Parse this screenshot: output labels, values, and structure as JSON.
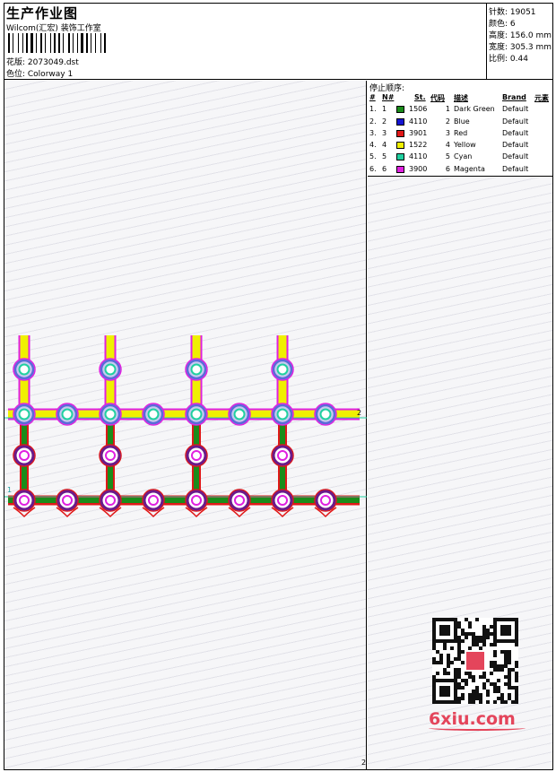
{
  "header": {
    "title": "生产作业图",
    "company": "Wilcom(汇宏) 装饰工作室",
    "design_label": "花版: 2073049.dst",
    "colorway_label": "色位:  Colorway 1"
  },
  "stats": {
    "stitches": "针数:  19051",
    "colors": "颜色:  6",
    "height": "高度:  156.0 mm",
    "width": "宽度:  305.3 mm",
    "scale": "比例:  0.44"
  },
  "stop_sequence": {
    "title": "停止顺序:",
    "columns": [
      "#",
      "N#",
      "St.",
      "代码",
      "描述",
      "Brand",
      "元素"
    ],
    "rows": [
      {
        "idx": "1.",
        "n": "1",
        "color": "#1a8c1a",
        "st": "1506",
        "code": "1",
        "desc": "Dark Green",
        "brand": "Default"
      },
      {
        "idx": "2.",
        "n": "2",
        "color": "#1414d2",
        "st": "4110",
        "code": "2",
        "desc": "Blue",
        "brand": "Default"
      },
      {
        "idx": "3.",
        "n": "3",
        "color": "#e01818",
        "st": "3901",
        "code": "3",
        "desc": "Red",
        "brand": "Default"
      },
      {
        "idx": "4.",
        "n": "4",
        "color": "#f0f000",
        "st": "1522",
        "code": "4",
        "desc": "Yellow",
        "brand": "Default"
      },
      {
        "idx": "5.",
        "n": "5",
        "color": "#20d0a0",
        "st": "4110",
        "code": "5",
        "desc": "Cyan",
        "brand": "Default"
      },
      {
        "idx": "6.",
        "n": "6",
        "color": "#e020e0",
        "st": "3900",
        "code": "6",
        "desc": "Magenta",
        "brand": "Default"
      }
    ]
  },
  "canvas_marks": {
    "top_marker": "2",
    "bottom_marker": "1",
    "bottom_edge": "2"
  },
  "watermark": {
    "site": "6xiu.com",
    "color": "#e4455b"
  },
  "thread_colors": {
    "green": "#1a8c1a",
    "blue": "#1414d2",
    "red": "#e01818",
    "yellow": "#f0f000",
    "cyan": "#20d0a0",
    "magenta": "#e020e0",
    "purple": "#6a1a8a"
  }
}
